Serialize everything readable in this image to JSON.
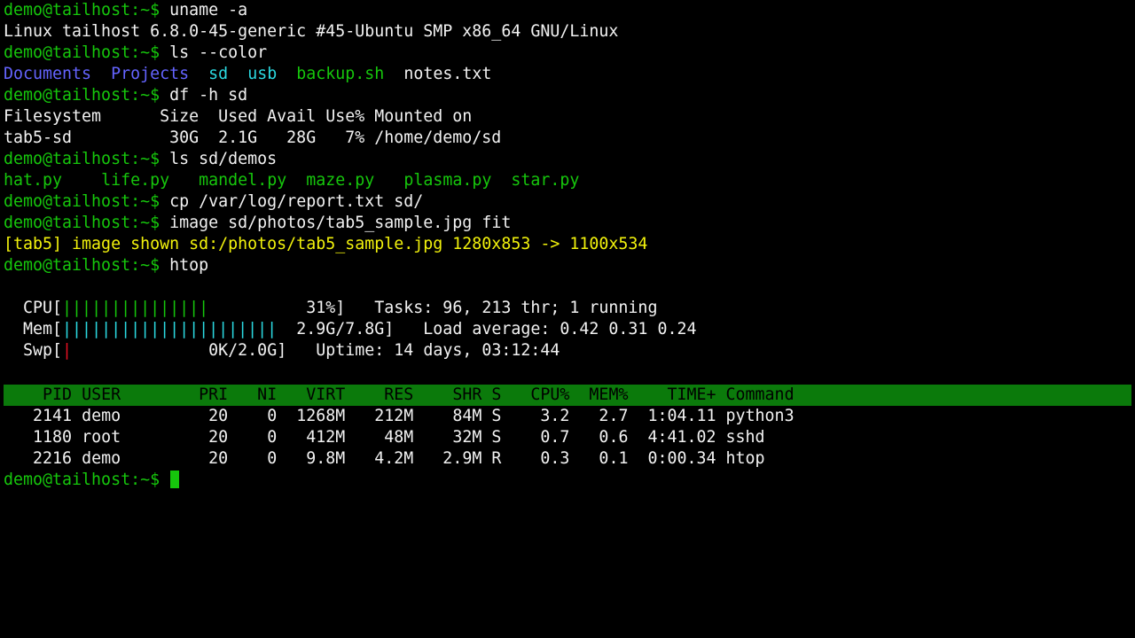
{
  "prompt": "demo@tailhost:~$",
  "lines": [
    {
      "cmd": "uname -a",
      "output": "Linux tailhost 6.8.0-45-generic #45-Ubuntu SMP x86_64 GNU/Linux"
    },
    {
      "cmd": "ls --color"
    },
    {
      "cmd": "df -h sd"
    },
    {
      "cmd": "ls sd/demos"
    },
    {
      "cmd": "cp /var/log/report.txt sd/"
    },
    {
      "cmd": "image sd/photos/tab5_sample.jpg fit",
      "output": "[tab5] image shown sd:/photos/tab5_sample.jpg 1280x853 -> 1100x534"
    },
    {
      "cmd": "htop"
    }
  ],
  "ls_color": {
    "dirs": [
      "Documents",
      "Projects"
    ],
    "links": [
      "sd",
      "usb"
    ],
    "exec": [
      "backup.sh"
    ],
    "files": [
      "notes.txt"
    ]
  },
  "df": {
    "header": "Filesystem      Size  Used Avail Use% Mounted on",
    "row": "tab5-sd          30G  2.1G   28G   7% /home/demo/sd"
  },
  "demos": [
    "hat.py",
    "life.py",
    "mandel.py",
    "maze.py",
    "plasma.py",
    "star.py"
  ],
  "htop": {
    "cpu": {
      "label": "CPU[",
      "bars": "|||||||||||||||",
      "value": "31%]",
      "info": "Tasks: 96, 213 thr; 1 running"
    },
    "mem": {
      "label": "Mem[",
      "bars": "||||||||||||||||||||||",
      "value": "2.9G/7.8G]",
      "info": "Load average: 0.42 0.31 0.24"
    },
    "swp": {
      "label": "Swp[",
      "bars": "|",
      "value": "0K/2.0G]",
      "info": "Uptime: 14 days, 03:12:44"
    },
    "columns": [
      "PID",
      "USER",
      "PRI",
      "NI",
      "VIRT",
      "RES",
      "SHR",
      "S",
      "CPU%",
      "MEM%",
      "TIME+",
      "Command"
    ],
    "processes": [
      {
        "pid": "2141",
        "user": "demo",
        "pri": "20",
        "ni": "0",
        "virt": "1268M",
        "res": "212M",
        "shr": "84M",
        "s": "S",
        "cpu": "3.2",
        "mem": "2.7",
        "time": "1:04.11",
        "command": "python3"
      },
      {
        "pid": "1180",
        "user": "root",
        "pri": "20",
        "ni": "0",
        "virt": "412M",
        "res": "48M",
        "shr": "32M",
        "s": "S",
        "cpu": "0.7",
        "mem": "0.6",
        "time": "4:41.02",
        "command": "sshd"
      },
      {
        "pid": "2216",
        "user": "demo",
        "pri": "20",
        "ni": "0",
        "virt": "9.8M",
        "res": "4.2M",
        "shr": "2.9M",
        "s": "R",
        "cpu": "0.3",
        "mem": "0.1",
        "time": "0:00.34",
        "command": "htop"
      }
    ]
  },
  "colors": {
    "prompt": "#16c60c",
    "dir": "#6464ff",
    "link": "#2bd9e0",
    "exec": "#16c60c",
    "notice": "#f2f20c",
    "header_bg": "#0b7a0b"
  }
}
